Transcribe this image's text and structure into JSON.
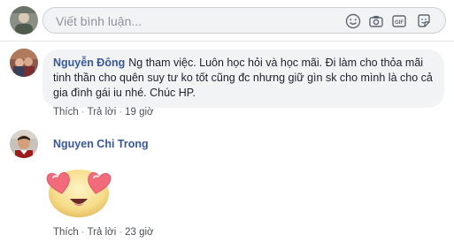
{
  "composer": {
    "placeholder": "Viết bình luận...",
    "icons": [
      "emoji-icon",
      "camera-icon",
      "gif-icon",
      "sticker-icon"
    ]
  },
  "comments": [
    {
      "author": "Nguyễn Đông",
      "text": "Ng tham việc. Luôn học hỏi và học mãi. Đi làm cho thỏa mãi tinh thần cho quên suy tư ko tốt cũng đc nhưng giữ gìn sk cho mình là cho cả gia đình gái iu nhé. Chúc HP.",
      "like_label": "Thích",
      "reply_label": "Trả lời",
      "time": "19 giờ"
    },
    {
      "author": "Nguyen Chi Trong",
      "sticker": "heart-eyes-emoji",
      "like_label": "Thích",
      "reply_label": "Trả lời",
      "time": "23 giờ"
    }
  ],
  "colors": {
    "link": "#385898",
    "muted": "#90949c",
    "bubble": "#f2f3f5"
  }
}
